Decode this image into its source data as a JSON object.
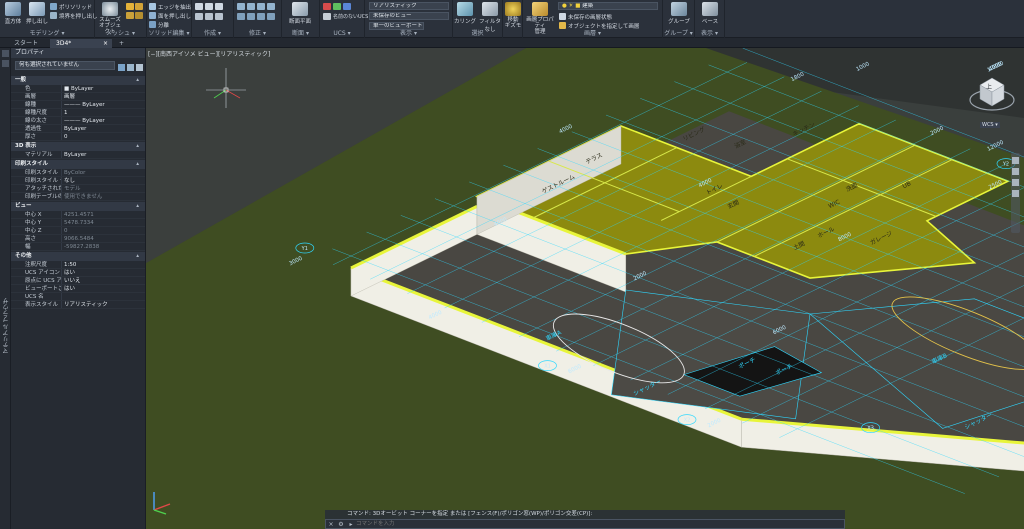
{
  "ribbon": {
    "groups": [
      {
        "key": "modeling",
        "title": "モデリング ▾"
      },
      {
        "key": "mesh",
        "title": "メッシュ ▾"
      },
      {
        "key": "solid_edit",
        "title": "ソリッド編集 ▾"
      },
      {
        "key": "create",
        "title": "作成 ▾"
      },
      {
        "key": "modify",
        "title": "修正 ▾"
      },
      {
        "key": "section",
        "title": "断面 ▾"
      },
      {
        "key": "ucs",
        "title": "UCS ▾"
      },
      {
        "key": "view",
        "title": "表示 ▾"
      },
      {
        "key": "select",
        "title": "選択"
      },
      {
        "key": "layer",
        "title": "画層 ▾"
      },
      {
        "key": "group",
        "title": "グループ ▾"
      },
      {
        "key": "display",
        "title": "表示 ▾"
      }
    ],
    "buttons": {
      "box": "直方体",
      "extrude": "押し出し",
      "polysolid": "ポリソリッド",
      "presspull": "境界を押し出し",
      "smooth_object": "スムーズ\nオブジェクト",
      "extract_edges": "エッジを抽出",
      "extrude_faces": "面を押し出し",
      "separate": "分離",
      "section_plane": "断面平面",
      "section_sub": "ジオメトリ",
      "visual_style": "リアリスティック",
      "view_saved": "未保存のビュー",
      "viewport": "単一のビューポート",
      "unsaved_ucs": "名前のないUCS",
      "culling": "カリング",
      "no_filter": "フィルタなし",
      "move_gizmo": "移動\nギズモ",
      "layer_props": "画層プロパティ\n管理",
      "layer_name": "建築",
      "layer_unsaved": "未保存の画層状態",
      "isolate_layer": "オブジェクトを指定して画層",
      "group": "グループ",
      "base": "ベース"
    }
  },
  "tabs": [
    {
      "label": "スタート",
      "active": false
    },
    {
      "label": "3D4*",
      "active": true
    }
  ],
  "properties": {
    "title": "プロパティ",
    "selection": "何も選択されていません",
    "sections": [
      {
        "title": "一般",
        "rows": [
          {
            "k": "色",
            "v": "■ ByLayer"
          },
          {
            "k": "画層",
            "v": "画層"
          },
          {
            "k": "線種",
            "v": "——— ByLayer"
          },
          {
            "k": "線種尺度",
            "v": "1"
          },
          {
            "k": "線の太さ",
            "v": "——— ByLayer"
          },
          {
            "k": "透過性",
            "v": "ByLayer"
          },
          {
            "k": "厚さ",
            "v": "0"
          }
        ]
      },
      {
        "title": "3D 表示",
        "rows": [
          {
            "k": "マテリアル",
            "v": "ByLayer"
          }
        ]
      },
      {
        "title": "印刷スタイル",
        "rows": [
          {
            "k": "印刷スタイル",
            "v": "ByColor",
            "dim": true
          },
          {
            "k": "印刷スタイル テーブル",
            "v": "なし"
          },
          {
            "k": "アタッチされた印刷テー…",
            "v": "モデル",
            "dim": true
          },
          {
            "k": "印刷テーブルのタイプ",
            "v": "使用できません",
            "dim": true
          }
        ]
      },
      {
        "title": "ビュー",
        "rows": [
          {
            "k": "中心 X",
            "v": "4251.4571",
            "dim": true
          },
          {
            "k": "中心 Y",
            "v": "5478.7334",
            "dim": true
          },
          {
            "k": "中心 Z",
            "v": "0",
            "dim": true
          },
          {
            "k": "高さ",
            "v": "9066.5484",
            "dim": true
          },
          {
            "k": "幅",
            "v": "-59827.2838",
            "dim": true
          }
        ]
      },
      {
        "title": "その他",
        "rows": [
          {
            "k": "注釈尺度",
            "v": "1:50"
          },
          {
            "k": "UCS アイコン オン",
            "v": "はい"
          },
          {
            "k": "原点に UCS アイコン",
            "v": "いいえ"
          },
          {
            "k": "ビューポートごとの UCS",
            "v": "はい"
          },
          {
            "k": "UCS 名",
            "v": ""
          },
          {
            "k": "表示スタイル",
            "v": "リアリスティック"
          }
        ]
      }
    ],
    "side_label": "マテリアル ブラウザ"
  },
  "viewport": {
    "label": "[−][南西アイソメ ビュー][リアリスティック]"
  },
  "drawing": {
    "rooms": [
      "リビング",
      "キッチン",
      "洗面",
      "トイレ",
      "UB",
      "テラス",
      "玄関",
      "ホール",
      "ゲストルーム",
      "土間",
      "浴室",
      "WIC",
      "ガレージ"
    ],
    "garages": [
      "車庫A",
      "車庫B"
    ],
    "shutters": [
      "シャッター",
      "シャッター"
    ],
    "porch": [
      "ポーチ",
      "ポーチ"
    ],
    "dims": [
      "3000",
      "1800",
      "4000",
      "2000",
      "6000",
      "2500",
      "2000",
      "1000",
      "4000",
      "4000",
      "2000",
      "8000",
      "6000",
      "12000",
      "4000",
      "4000",
      "4000",
      "10000",
      "8000"
    ],
    "grid_labels": [
      "Y1",
      "X1",
      "X2",
      "X3",
      "Y2"
    ]
  },
  "navcube": {
    "label": "上",
    "wcs": "WCS ▾"
  },
  "cmd": {
    "history": "コマンド: 3Dオービット コーナーを指定 または [フェンス(F)/ポリゴン窓(WP)/ポリゴン交差(CP)]:",
    "placeholder": "コマンドを入力"
  },
  "colors": {
    "floor": "#8c8a0f",
    "wall_top": "#e8f53a",
    "wall_side": "#f0efe6",
    "slab": "#494742",
    "grid": "#2fd8ff",
    "background": "#3b3f3d",
    "grass": "#3f4d22"
  }
}
